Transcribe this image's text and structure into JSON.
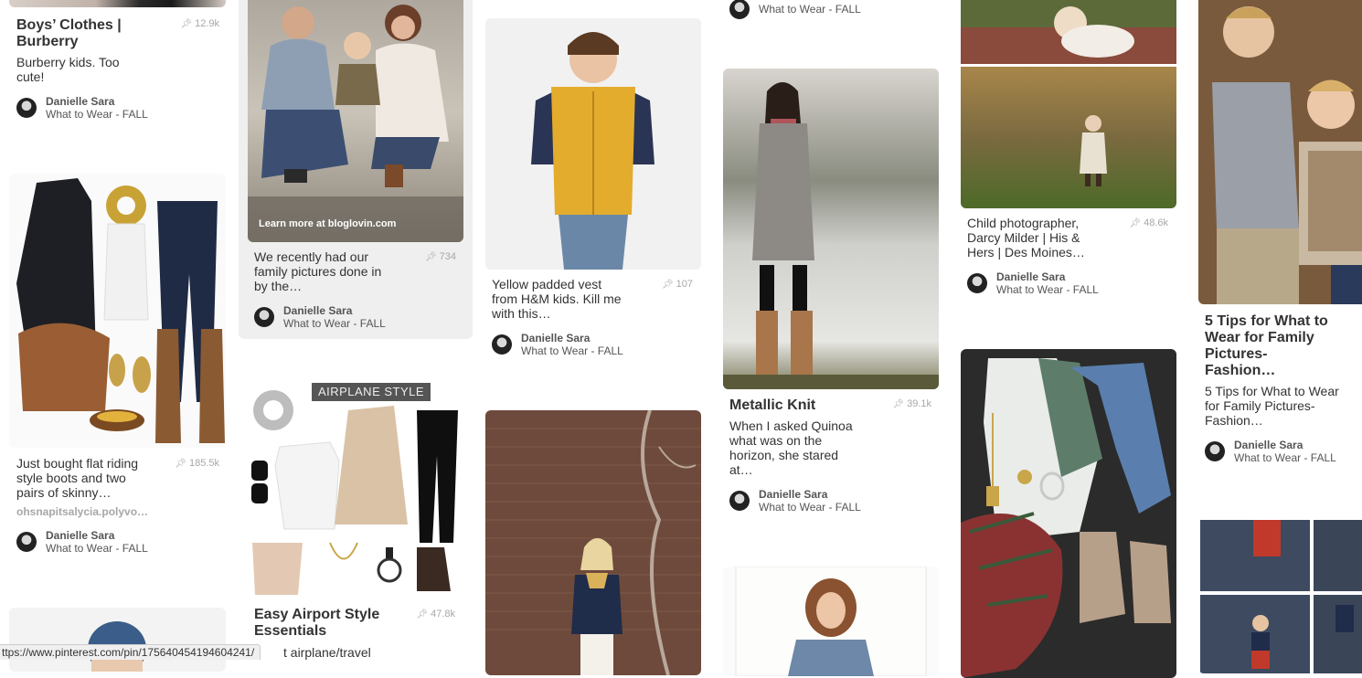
{
  "pins": {
    "burberry": {
      "title": "Boys’ Clothes | Burberry",
      "description": "Burberry kids. Too cute!",
      "repins": "12.9k",
      "pinner": "Danielle Sara",
      "board": "What to Wear - FALL"
    },
    "boots_outfit": {
      "description": "Just bought flat riding style boots and two pairs of skinny…",
      "repins": "185.5k",
      "source": "ohsnapitsalycia.polyvo…",
      "pinner": "Danielle Sara",
      "board": "What to Wear - FALL"
    },
    "family_pictures": {
      "overlay": "Learn more at bloglovin.com",
      "description": "We recently had our family pictures done in by the…",
      "repins": "734",
      "pinner": "Danielle Sara",
      "board": "What to Wear - FALL"
    },
    "airport_style": {
      "banner": "AIRPLANE STYLE",
      "title": "Easy Airport Style Essentials",
      "description_fragment": "t airplane/travel",
      "repins": "47.8k"
    },
    "yellow_vest": {
      "description": "Yellow padded vest from H&M kids. Kill me with this…",
      "repins": "107",
      "pinner": "Danielle Sara",
      "board": "What to Wear - FALL"
    },
    "top_partial": {
      "board": "What to Wear - FALL"
    },
    "metallic_knit": {
      "title": "Metallic Knit",
      "description": "When I asked Quinoa what was on the horizon, she stared at…",
      "repins": "39.1k",
      "pinner": "Danielle Sara",
      "board": "What to Wear - FALL"
    },
    "child_photographer": {
      "description": "Child photographer, Darcy Milder | His & Hers | Des Moines…",
      "repins": "48.6k",
      "pinner": "Danielle Sara",
      "board": "What to Wear - FALL"
    },
    "five_tips": {
      "title": "5 Tips for What to Wear for Family Pictures- Fashion…",
      "description": "5 Tips for What to Wear for Family Pictures- Fashion…",
      "pinner": "Danielle Sara",
      "board": "What to Wear - FALL"
    }
  },
  "status_url": "ttps://www.pinterest.com/pin/175640454194604241/",
  "icons": {
    "pin": "pushpin-icon",
    "avatar": "avatar"
  }
}
